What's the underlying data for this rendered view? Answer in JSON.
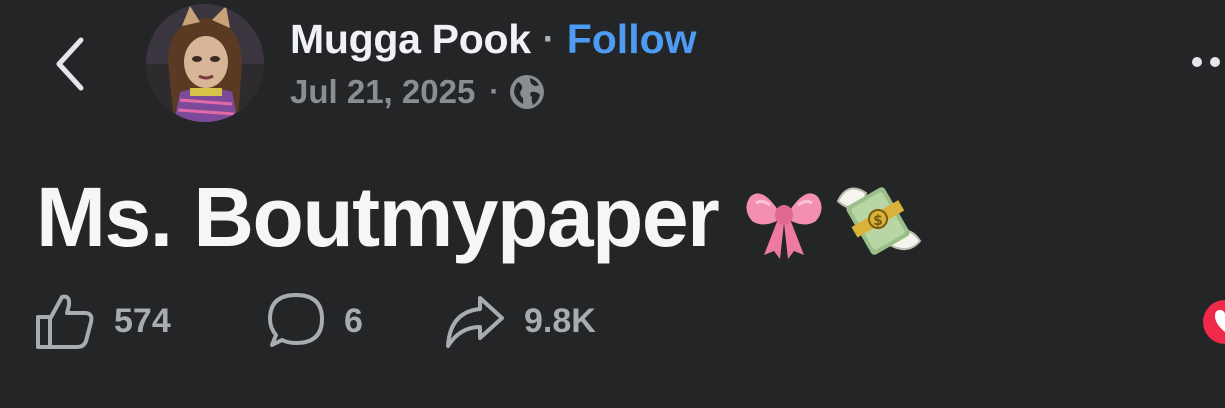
{
  "post": {
    "author_name": "Mugga Pook",
    "separator": "·",
    "follow_label": "Follow",
    "date": "Jul 21, 2025",
    "meta_separator": "·",
    "audience_icon": "globe-icon",
    "text": "Ms. Boutmypaper",
    "emojis": [
      "ribbon-emoji",
      "money-with-wings-emoji"
    ]
  },
  "actions": {
    "like_count": "574",
    "comment_count": "6",
    "share_count": "9.8K"
  },
  "colors": {
    "background": "#242526",
    "primary_text": "#f0f2f5",
    "secondary_text": "#8a8d91",
    "link": "#4d9bf2",
    "reaction_red": "#f02849"
  }
}
